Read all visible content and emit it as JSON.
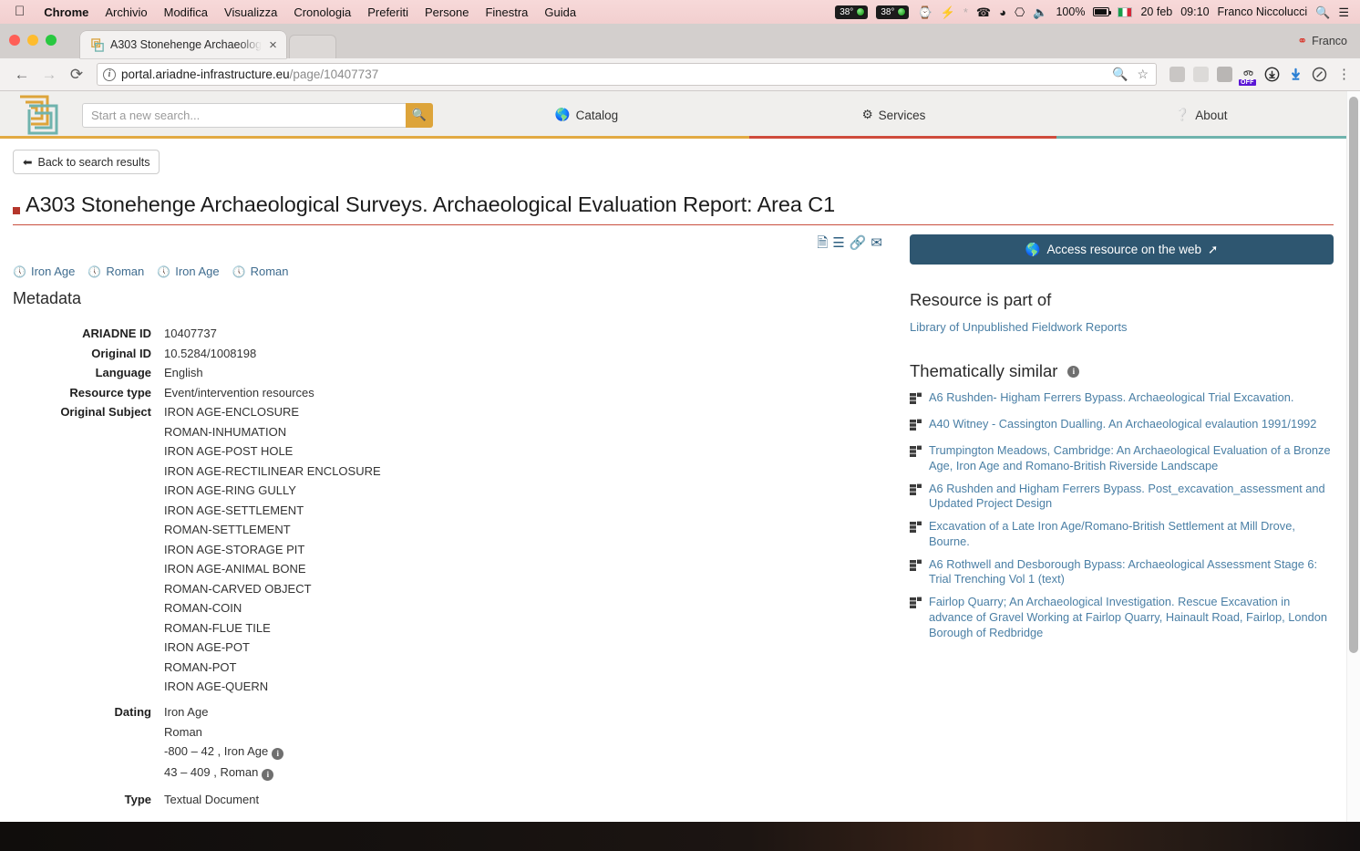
{
  "menubar": {
    "apple_icon": "apple-logo",
    "items": [
      {
        "label": "Chrome",
        "bold": true
      },
      {
        "label": "Archivio",
        "bold": false
      },
      {
        "label": "Modifica",
        "bold": false
      },
      {
        "label": "Visualizza",
        "bold": false
      },
      {
        "label": "Cronologia",
        "bold": false
      },
      {
        "label": "Preferiti",
        "bold": false
      },
      {
        "label": "Persone",
        "bold": false
      },
      {
        "label": "Finestra",
        "bold": false
      },
      {
        "label": "Guida",
        "bold": false
      }
    ],
    "status": {
      "temp1": "38°",
      "temp2": "38°",
      "battery_percent": "100%",
      "date": "20 feb",
      "time": "09:10",
      "user": "Franco Niccolucci",
      "icons": [
        "time-machine-icon",
        "lightning-icon",
        "bluetooth-icon",
        "phone-icon",
        "wifi-icon",
        "airplay-icon",
        "volume-icon",
        "battery-icon",
        "italian-flag-icon",
        "spotlight-search-icon",
        "notification-center-icon"
      ]
    }
  },
  "browser": {
    "tab": {
      "title": "A303 Stonehenge Archaeolog",
      "close_label": "×",
      "favicon": "ariadne-favicon"
    },
    "profile_label": "Franco",
    "nav": {
      "back": "←",
      "forward": "→",
      "reload": "⟳"
    },
    "omnibox": {
      "info_icon": "site-info-icon",
      "url_domain": "portal.ariadne-infrastructure.eu",
      "url_path": "/page/10407737",
      "zoom_icon": "zoom-out-icon",
      "star_icon": "bookmark-star-icon"
    },
    "extensions": [
      {
        "name": "pocket-extension-icon",
        "color": "#c9c6c4",
        "badge": ""
      },
      {
        "name": "google-drive-extension-icon",
        "color": "#dcdad8",
        "badge": ""
      },
      {
        "name": "lightbulb-extension-icon",
        "color": "#b9b6b4",
        "badge": ""
      },
      {
        "name": "glasses-extension-icon",
        "color": "#e8e6e4",
        "badge": "OFF"
      },
      {
        "name": "download-circle-icon",
        "color": "#e9e7e5",
        "badge": ""
      },
      {
        "name": "blue-arrow-download-icon",
        "color": "#e9e7e5",
        "badge": ""
      },
      {
        "name": "speedometer-extension-icon",
        "color": "#e9e7e5",
        "badge": ""
      }
    ],
    "menu_icon": "kebab-menu-icon"
  },
  "site": {
    "logo_alt": "ariadne-labyrinth-logo",
    "search": {
      "placeholder": "Start a new search...",
      "value": "",
      "button_icon": "search-icon"
    },
    "nav_items": [
      {
        "label": "Catalog",
        "icon": "globe-icon"
      },
      {
        "label": "Services",
        "icon": "gear-icon"
      },
      {
        "label": "About",
        "icon": "question-circle-icon"
      }
    ],
    "nav_underline_colors": [
      "#e2aa43",
      "#cf4b3c",
      "#6fb3ad"
    ],
    "back_button": {
      "label": "Back to search results",
      "icon": "arrow-left-icon"
    }
  },
  "resource": {
    "title": "A303 Stonehenge Archaeological Surveys. Archaeological Evaluation Report: Area C1",
    "title_accent": "#b5362b",
    "action_icons": [
      {
        "name": "document-icon",
        "glyph": "🗎"
      },
      {
        "name": "citation-list-icon",
        "glyph": "☰"
      },
      {
        "name": "permalink-icon",
        "glyph": "🔗"
      },
      {
        "name": "email-icon",
        "glyph": "✉"
      }
    ],
    "access_button": {
      "label": "Access resource on the web",
      "icon": "globe-icon",
      "external_icon": "external-link-icon",
      "color": "#2e5670"
    },
    "periods": [
      {
        "label": "Iron Age",
        "icon": "clock-icon"
      },
      {
        "label": "Roman",
        "icon": "clock-icon"
      },
      {
        "label": "Iron Age",
        "icon": "clock-icon"
      },
      {
        "label": "Roman",
        "icon": "clock-icon"
      }
    ],
    "metadata_heading": "Metadata",
    "metadata": [
      {
        "label": "ARIADNE ID",
        "values": [
          "10407737"
        ]
      },
      {
        "label": "Original ID",
        "values": [
          "10.5284/1008198"
        ]
      },
      {
        "label": "Language",
        "values": [
          "English"
        ]
      },
      {
        "label": "Resource type",
        "values": [
          "Event/intervention resources"
        ]
      },
      {
        "label": "Original Subject",
        "values": [
          "IRON AGE-ENCLOSURE",
          "ROMAN-INHUMATION",
          "IRON AGE-POST HOLE",
          "IRON AGE-RECTILINEAR ENCLOSURE",
          "IRON AGE-RING GULLY",
          "IRON AGE-SETTLEMENT",
          "ROMAN-SETTLEMENT",
          "IRON AGE-STORAGE PIT",
          "IRON AGE-ANIMAL BONE",
          "ROMAN-CARVED OBJECT",
          "ROMAN-COIN",
          "ROMAN-FLUE TILE",
          "IRON AGE-POT",
          "ROMAN-POT",
          "IRON AGE-QUERN"
        ]
      },
      {
        "label": "Dating",
        "values": [
          "Iron Age",
          "Roman"
        ],
        "values_with_info": [
          "-800 – 42 , Iron Age",
          "43 – 409 , Roman"
        ]
      },
      {
        "label": "Type",
        "values": [
          "Textual Document"
        ]
      }
    ]
  },
  "sidebar": {
    "part_of_heading": "Resource is part of",
    "part_of_link": "Library of Unpublished Fieldwork Reports",
    "similar_heading": "Thematically similar",
    "similar_info_icon": "info-icon",
    "similar_items": [
      "A6 Rushden- Higham Ferrers Bypass. Archaeological Trial Excavation.",
      "A40 Witney - Cassington Dualling. An Archaeological evalaution 1991/1992",
      "Trumpington Meadows, Cambridge: An Archaeological Evaluation of a Bronze Age, Iron Age and Romano-British Riverside Landscape",
      "A6 Rushden and Higham Ferrers Bypass. Post_excavation_assessment and Updated Project Design",
      "Excavation of a Late Iron Age/Romano-British Settlement at Mill Drove, Bourne.",
      "A6 Rothwell and Desborough Bypass: Archaeological Assessment Stage 6: Trial Trenching Vol 1 (text)",
      "Fairlop Quarry; An Archaeological Investigation. Rescue Excavation in advance of Gravel Working at Fairlop Quarry, Hainault Road, Fairlop, London Borough of Redbridge"
    ]
  }
}
